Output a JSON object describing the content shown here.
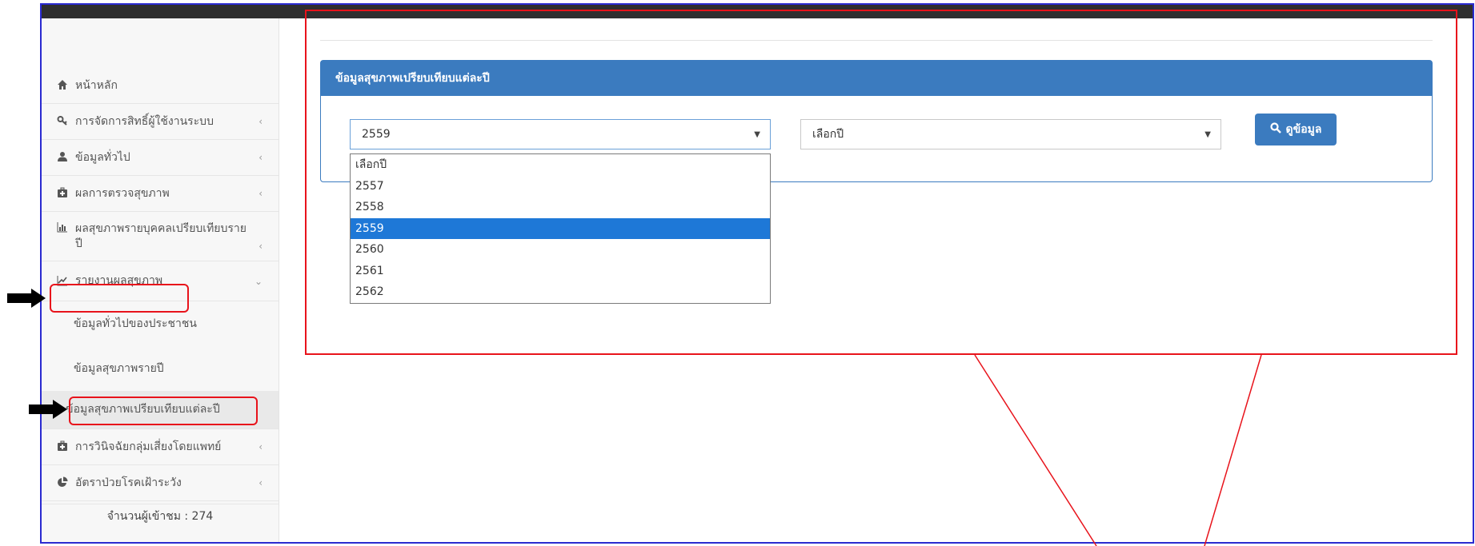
{
  "sidebar": {
    "items": [
      {
        "label": "หน้าหลัก",
        "icon": "home-icon",
        "chevron": ""
      },
      {
        "label": "การจัดการสิทธิ์ผู้ใช้งานระบบ",
        "icon": "key-icon",
        "chevron": "‹"
      },
      {
        "label": "ข้อมูลทั่วไป",
        "icon": "user-icon",
        "chevron": "‹"
      },
      {
        "label": "ผลการตรวจสุขภาพ",
        "icon": "medkit-icon",
        "chevron": "‹"
      },
      {
        "label": "ผลสุขภาพรายบุคคลเปรียบเทียบรายปี",
        "icon": "bar-chart-icon",
        "chevron": "‹"
      },
      {
        "label": "รายงานผลสุขภาพ",
        "icon": "line-chart-icon",
        "chevron": "⌄"
      }
    ],
    "subitems": [
      {
        "label": "ข้อมูลทั่วไปของประชาชน"
      },
      {
        "label": "ข้อมูลสุขภาพรายปี"
      },
      {
        "label": "ข้อมูลสุขภาพเปรียบเทียบแต่ละปี"
      }
    ],
    "bottom_items": [
      {
        "label": "การวินิจฉัยกลุ่มเสี่ยงโดยแพทย์",
        "icon": "medkit-icon",
        "chevron": "‹"
      },
      {
        "label": "อัตราป่วยโรคเฝ้าระวัง",
        "icon": "pie-chart-icon",
        "chevron": "‹"
      }
    ],
    "visitors": "จำนวนผู้เข้าชม : 274"
  },
  "panel": {
    "title": "ข้อมูลสุขภาพเปรียบเทียบแต่ละปี",
    "select1_value": "2559",
    "select2_value": "เลือกปี",
    "button_label": "ดูข้อมูล",
    "dropdown_options": [
      "เลือกปี",
      "2557",
      "2558",
      "2559",
      "2560",
      "2561",
      "2562"
    ],
    "dropdown_selected": "2559"
  },
  "colors": {
    "accent": "#3b7bbf",
    "highlight": "#1e78d7",
    "annotation": "#e8131b",
    "frame": "#2b2bd0"
  }
}
